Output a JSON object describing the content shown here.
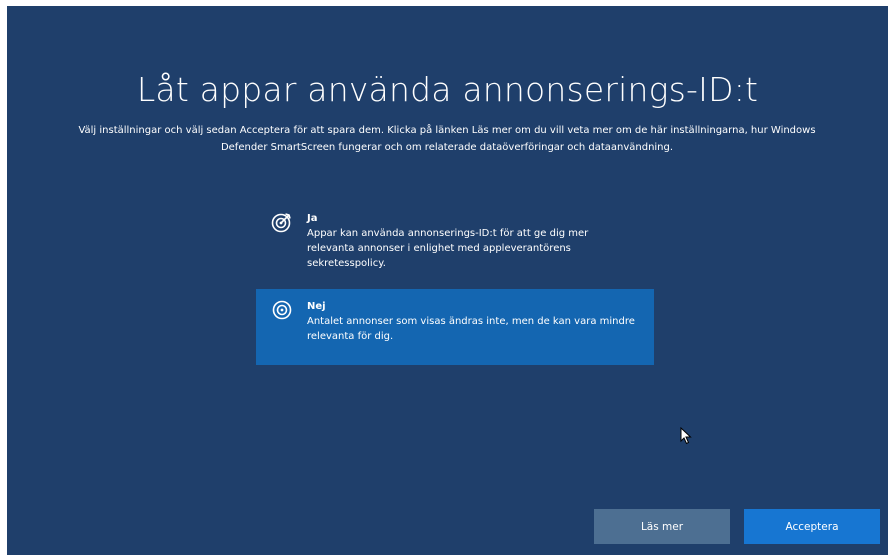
{
  "setup": {
    "title": "Låt appar använda annonserings-ID:t",
    "subtitle": "Välj inställningar och välj sedan Acceptera för att spara dem. Klicka på länken Läs mer om du vill veta mer om de här inställningarna, hur Windows Defender SmartScreen fungerar och om relaterade dataöverföringar och dataanvändning."
  },
  "options": [
    {
      "title": "Ja",
      "description": "Appar kan använda annonserings-ID:t för att ge dig mer relevanta annonser i enlighet med appleverantörens sekretesspolicy.",
      "icon": "target-check-icon",
      "selected": false
    },
    {
      "title": "Nej",
      "description": "Antalet annonser som visas ändras inte, men de kan vara mindre relevanta för dig.",
      "icon": "target-icon",
      "selected": true
    }
  ],
  "buttons": {
    "learn_more": "Läs mer",
    "accept": "Acceptera"
  },
  "colors": {
    "background": "#1f3f6b",
    "selected_option": "#1466b1",
    "learn_more_button": "#4d6f92",
    "accept_button": "#1776d2"
  }
}
